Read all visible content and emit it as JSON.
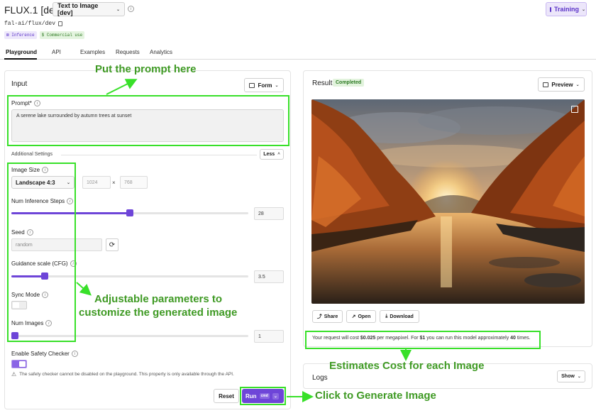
{
  "header": {
    "title": "FLUX.1 [dev]",
    "model_select": "Text to Image [dev]",
    "training_label": "Training",
    "model_path": "fal-ai/flux/dev",
    "badges": [
      "Inference",
      "$ Commercial use"
    ]
  },
  "tabs": [
    "Playground",
    "API",
    "Examples",
    "Requests",
    "Analytics"
  ],
  "input": {
    "title": "Input",
    "form_label": "Form",
    "prompt_label": "Prompt",
    "prompt_required": "*",
    "prompt_value": "A serene lake surrounded by autumn trees at sunset",
    "additional_settings": "Additional Settings",
    "less_label": "Less",
    "image_size_label": "Image Size",
    "image_size_value": "Landscape 4:3",
    "width": "1024",
    "height": "768",
    "times": "×",
    "steps_label": "Num Inference Steps",
    "steps_value": "28",
    "steps_fraction": 0.5,
    "seed_label": "Seed",
    "seed_placeholder": "random",
    "guidance_label": "Guidance scale (CFG)",
    "guidance_value": "3.5",
    "guidance_fraction": 0.14,
    "sync_label": "Sync Mode",
    "sync_on": false,
    "num_images_label": "Num Images",
    "num_images_value": "1",
    "num_images_fraction": 0.0,
    "safety_label": "Enable Safety Checker",
    "safety_on": true,
    "safety_warning": "The safety checker cannot be disabled on the playground. This property is only available through the API.",
    "reset_label": "Reset",
    "run_label": "Run",
    "run_kbd": "cmd"
  },
  "result": {
    "title": "Result",
    "status": "Completed",
    "preview_label": "Preview",
    "share_label": "Share",
    "open_label": "Open",
    "download_label": "Download",
    "cost_prefix": "Your request will cost ",
    "cost_price": "$0.025",
    "cost_mid": " per megapixel. For ",
    "cost_dollar": "$1",
    "cost_mid2": " you can run this model approximately ",
    "cost_times": "40",
    "cost_suffix": " times."
  },
  "logs": {
    "title": "Logs",
    "show_label": "Show"
  },
  "annotations": {
    "prompt": "Put the prompt here",
    "params_line1": "Adjustable parameters to",
    "params_line2": "customize the generated image",
    "cost": "Estimates Cost for each Image",
    "run": "Click to Generate Image"
  },
  "colors": {
    "accent": "#6e45d8",
    "annotation_green": "#38e029",
    "annotation_text": "#3f9a24"
  }
}
